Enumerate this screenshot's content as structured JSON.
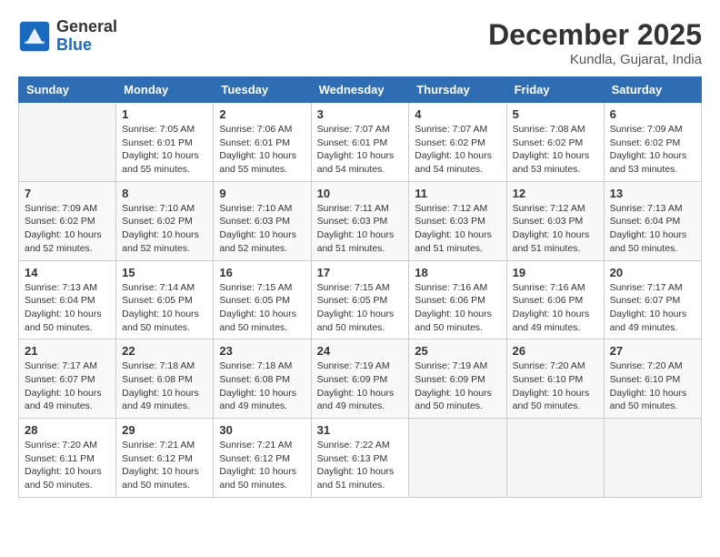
{
  "logo": {
    "general": "General",
    "blue": "Blue"
  },
  "header": {
    "month": "December 2025",
    "location": "Kundla, Gujarat, India"
  },
  "days_of_week": [
    "Sunday",
    "Monday",
    "Tuesday",
    "Wednesday",
    "Thursday",
    "Friday",
    "Saturday"
  ],
  "weeks": [
    [
      {
        "num": "",
        "info": ""
      },
      {
        "num": "1",
        "info": "Sunrise: 7:05 AM\nSunset: 6:01 PM\nDaylight: 10 hours\nand 55 minutes."
      },
      {
        "num": "2",
        "info": "Sunrise: 7:06 AM\nSunset: 6:01 PM\nDaylight: 10 hours\nand 55 minutes."
      },
      {
        "num": "3",
        "info": "Sunrise: 7:07 AM\nSunset: 6:01 PM\nDaylight: 10 hours\nand 54 minutes."
      },
      {
        "num": "4",
        "info": "Sunrise: 7:07 AM\nSunset: 6:02 PM\nDaylight: 10 hours\nand 54 minutes."
      },
      {
        "num": "5",
        "info": "Sunrise: 7:08 AM\nSunset: 6:02 PM\nDaylight: 10 hours\nand 53 minutes."
      },
      {
        "num": "6",
        "info": "Sunrise: 7:09 AM\nSunset: 6:02 PM\nDaylight: 10 hours\nand 53 minutes."
      }
    ],
    [
      {
        "num": "7",
        "info": "Sunrise: 7:09 AM\nSunset: 6:02 PM\nDaylight: 10 hours\nand 52 minutes."
      },
      {
        "num": "8",
        "info": "Sunrise: 7:10 AM\nSunset: 6:02 PM\nDaylight: 10 hours\nand 52 minutes."
      },
      {
        "num": "9",
        "info": "Sunrise: 7:10 AM\nSunset: 6:03 PM\nDaylight: 10 hours\nand 52 minutes."
      },
      {
        "num": "10",
        "info": "Sunrise: 7:11 AM\nSunset: 6:03 PM\nDaylight: 10 hours\nand 51 minutes."
      },
      {
        "num": "11",
        "info": "Sunrise: 7:12 AM\nSunset: 6:03 PM\nDaylight: 10 hours\nand 51 minutes."
      },
      {
        "num": "12",
        "info": "Sunrise: 7:12 AM\nSunset: 6:03 PM\nDaylight: 10 hours\nand 51 minutes."
      },
      {
        "num": "13",
        "info": "Sunrise: 7:13 AM\nSunset: 6:04 PM\nDaylight: 10 hours\nand 50 minutes."
      }
    ],
    [
      {
        "num": "14",
        "info": "Sunrise: 7:13 AM\nSunset: 6:04 PM\nDaylight: 10 hours\nand 50 minutes."
      },
      {
        "num": "15",
        "info": "Sunrise: 7:14 AM\nSunset: 6:05 PM\nDaylight: 10 hours\nand 50 minutes."
      },
      {
        "num": "16",
        "info": "Sunrise: 7:15 AM\nSunset: 6:05 PM\nDaylight: 10 hours\nand 50 minutes."
      },
      {
        "num": "17",
        "info": "Sunrise: 7:15 AM\nSunset: 6:05 PM\nDaylight: 10 hours\nand 50 minutes."
      },
      {
        "num": "18",
        "info": "Sunrise: 7:16 AM\nSunset: 6:06 PM\nDaylight: 10 hours\nand 50 minutes."
      },
      {
        "num": "19",
        "info": "Sunrise: 7:16 AM\nSunset: 6:06 PM\nDaylight: 10 hours\nand 49 minutes."
      },
      {
        "num": "20",
        "info": "Sunrise: 7:17 AM\nSunset: 6:07 PM\nDaylight: 10 hours\nand 49 minutes."
      }
    ],
    [
      {
        "num": "21",
        "info": "Sunrise: 7:17 AM\nSunset: 6:07 PM\nDaylight: 10 hours\nand 49 minutes."
      },
      {
        "num": "22",
        "info": "Sunrise: 7:18 AM\nSunset: 6:08 PM\nDaylight: 10 hours\nand 49 minutes."
      },
      {
        "num": "23",
        "info": "Sunrise: 7:18 AM\nSunset: 6:08 PM\nDaylight: 10 hours\nand 49 minutes."
      },
      {
        "num": "24",
        "info": "Sunrise: 7:19 AM\nSunset: 6:09 PM\nDaylight: 10 hours\nand 49 minutes."
      },
      {
        "num": "25",
        "info": "Sunrise: 7:19 AM\nSunset: 6:09 PM\nDaylight: 10 hours\nand 50 minutes."
      },
      {
        "num": "26",
        "info": "Sunrise: 7:20 AM\nSunset: 6:10 PM\nDaylight: 10 hours\nand 50 minutes."
      },
      {
        "num": "27",
        "info": "Sunrise: 7:20 AM\nSunset: 6:10 PM\nDaylight: 10 hours\nand 50 minutes."
      }
    ],
    [
      {
        "num": "28",
        "info": "Sunrise: 7:20 AM\nSunset: 6:11 PM\nDaylight: 10 hours\nand 50 minutes."
      },
      {
        "num": "29",
        "info": "Sunrise: 7:21 AM\nSunset: 6:12 PM\nDaylight: 10 hours\nand 50 minutes."
      },
      {
        "num": "30",
        "info": "Sunrise: 7:21 AM\nSunset: 6:12 PM\nDaylight: 10 hours\nand 50 minutes."
      },
      {
        "num": "31",
        "info": "Sunrise: 7:22 AM\nSunset: 6:13 PM\nDaylight: 10 hours\nand 51 minutes."
      },
      {
        "num": "",
        "info": ""
      },
      {
        "num": "",
        "info": ""
      },
      {
        "num": "",
        "info": ""
      }
    ]
  ]
}
